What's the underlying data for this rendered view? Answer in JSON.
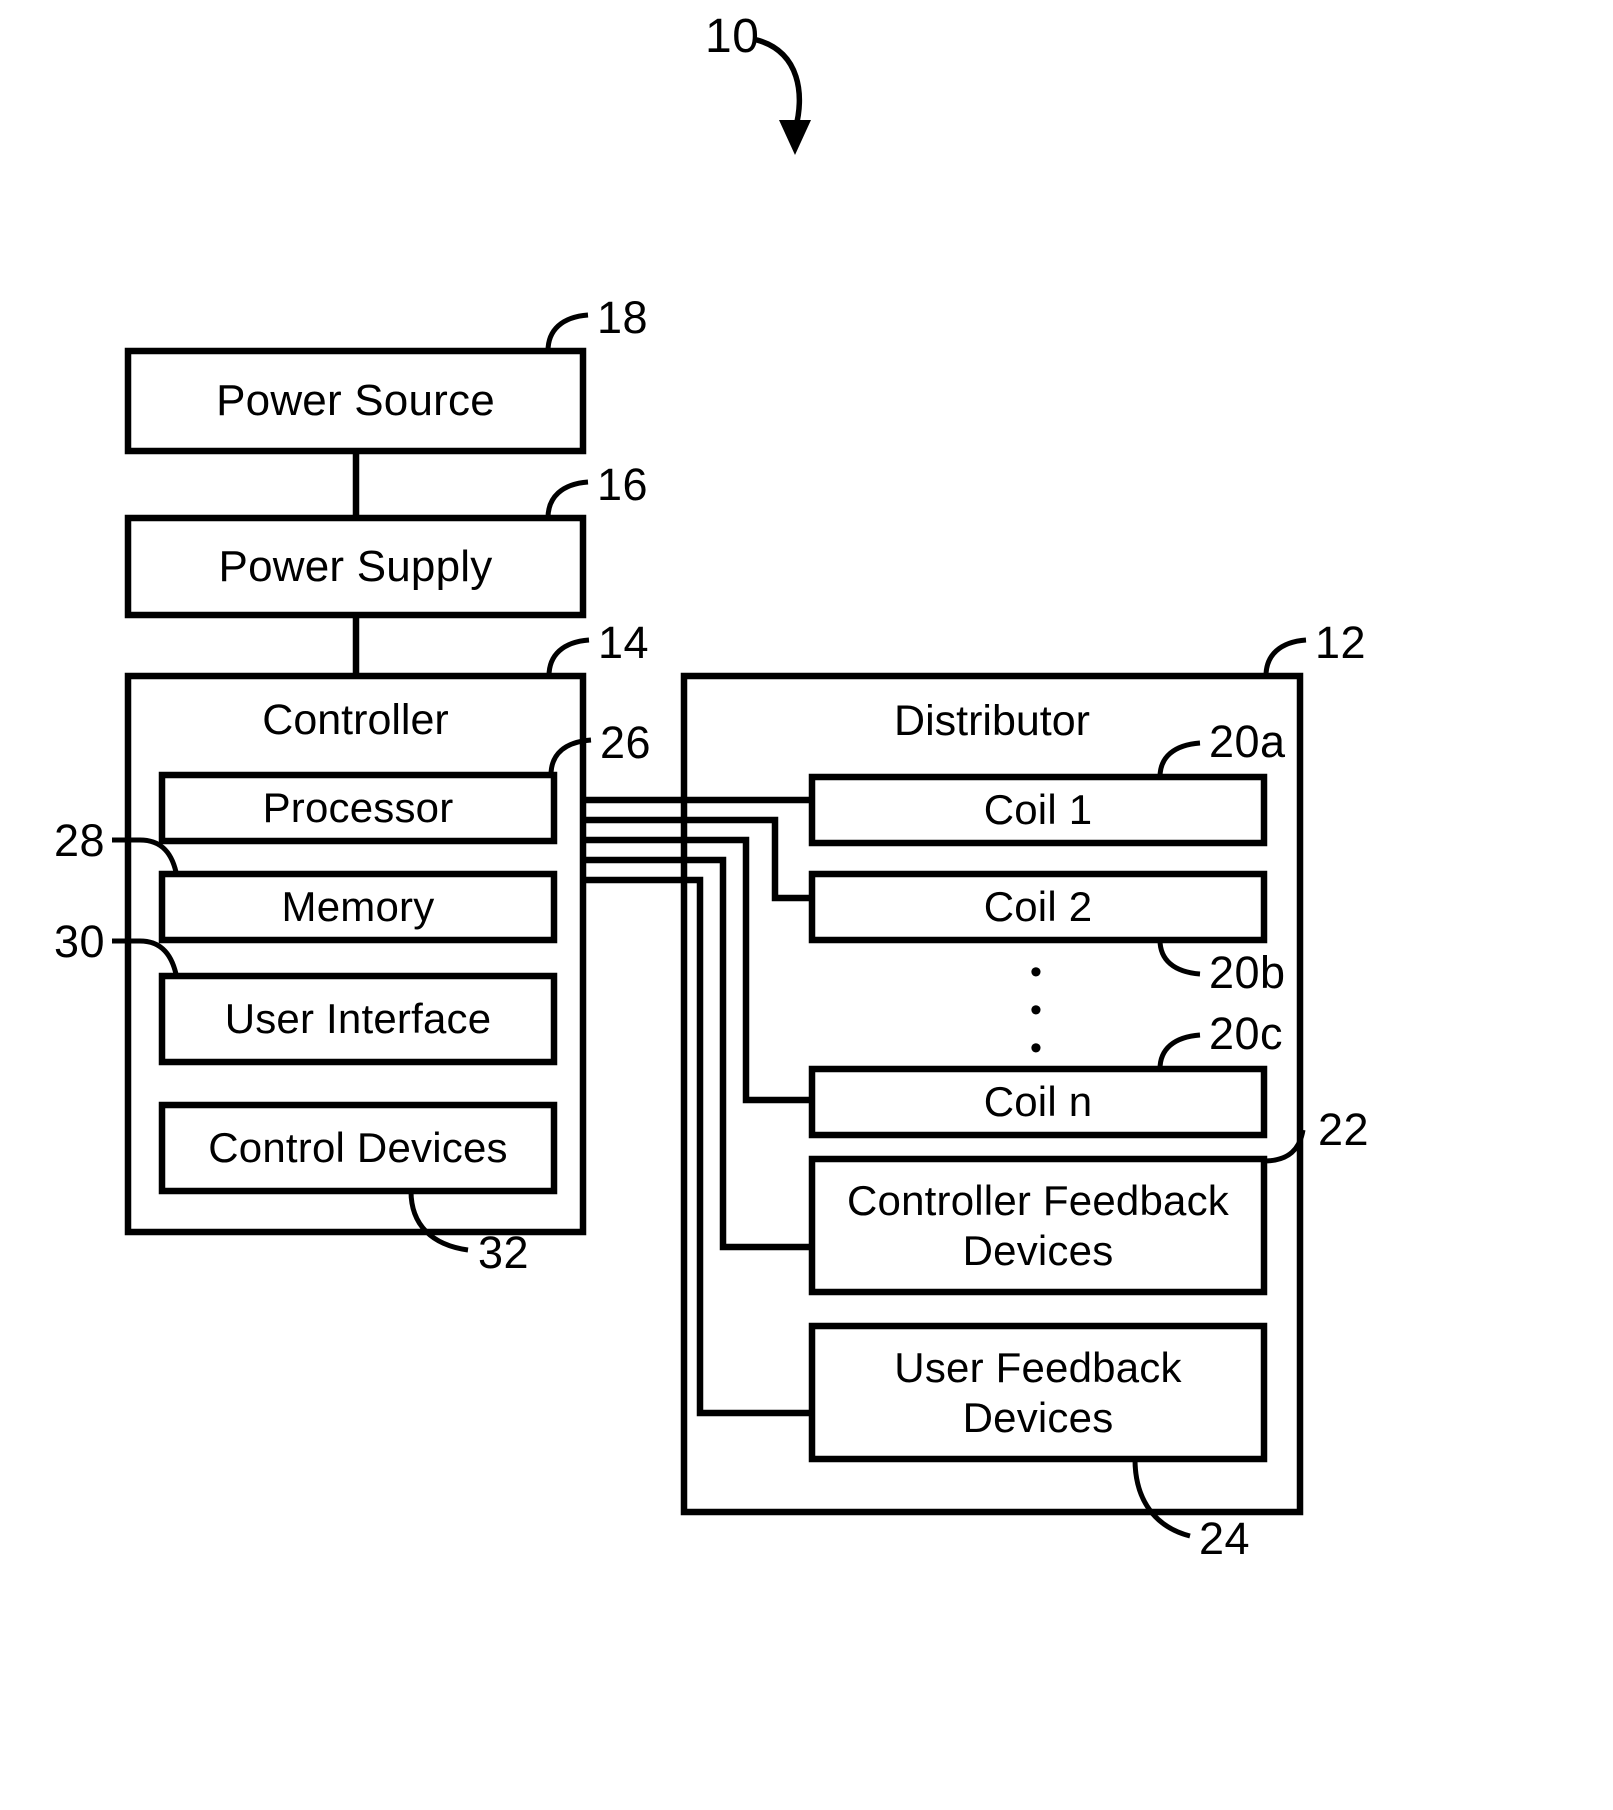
{
  "figure": {
    "figure_number": "10",
    "background_color": "#ffffff",
    "line_color": "#000000"
  },
  "blocks": {
    "power_source": {
      "label": "Power Source",
      "ref": "18"
    },
    "power_supply": {
      "label": "Power Supply",
      "ref": "16"
    },
    "controller": {
      "label": "Controller",
      "ref": "14"
    },
    "processor": {
      "label": "Processor",
      "ref": "26"
    },
    "memory": {
      "label": "Memory",
      "ref": "28"
    },
    "user_interface": {
      "label": "User Interface",
      "ref": "30"
    },
    "control_devices": {
      "label": "Control Devices",
      "ref": "32"
    },
    "distributor": {
      "label": "Distributor",
      "ref": "12"
    },
    "coil_1": {
      "label": "Coil 1",
      "ref": "20a"
    },
    "coil_2": {
      "label": "Coil 2",
      "ref": "20b"
    },
    "coil_n": {
      "label": "Coil n",
      "ref": "20c"
    },
    "controller_feedback_devices": {
      "label": "Controller Feedback\nDevices",
      "ref": "22"
    },
    "user_feedback_devices": {
      "label": "User Feedback\nDevices",
      "ref": "24"
    }
  },
  "ellipsis": {
    "symbol": "•",
    "count": 3,
    "orientation": "vertical"
  }
}
